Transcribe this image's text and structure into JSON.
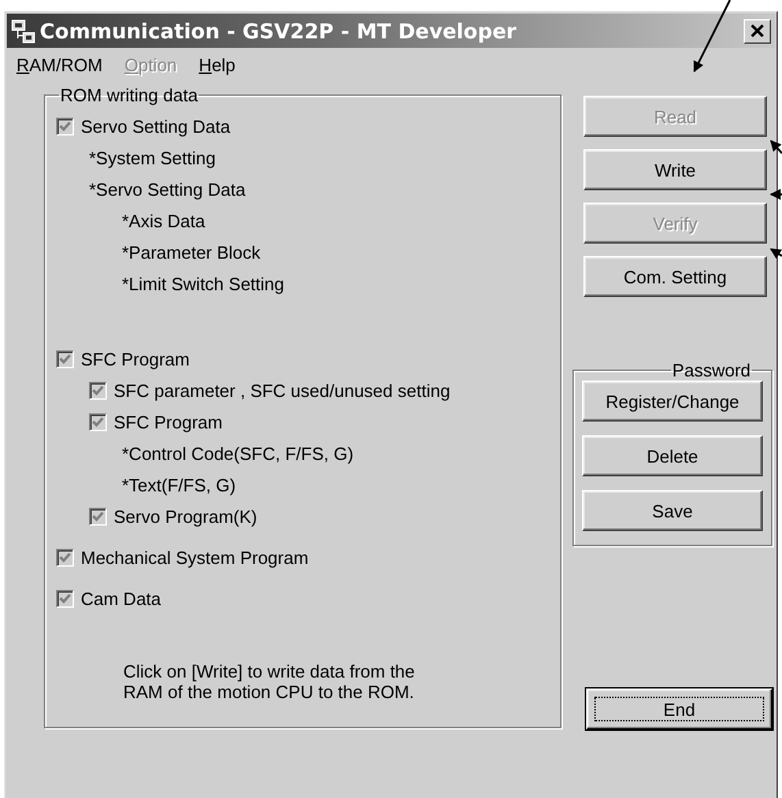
{
  "window": {
    "title": "Communication - GSV22P - MT Developer"
  },
  "menu": [
    {
      "label": "RAM/ROM",
      "disabled": false
    },
    {
      "label": "Option",
      "disabled": true
    },
    {
      "label": "Help",
      "disabled": false
    }
  ],
  "rom_group": {
    "title": "ROM writing data",
    "items": [
      {
        "kind": "checkbox",
        "label": "Servo Setting Data",
        "checked": true,
        "disabled": true,
        "children": [
          {
            "kind": "note",
            "label": "*System Setting"
          },
          {
            "kind": "note",
            "label": "*Servo Setting Data",
            "children": [
              {
                "kind": "note",
                "label": "*Axis Data"
              },
              {
                "kind": "note",
                "label": "*Parameter Block"
              },
              {
                "kind": "note",
                "label": "*Limit Switch Setting"
              }
            ]
          }
        ]
      },
      {
        "kind": "checkbox",
        "label": "SFC Program",
        "checked": true,
        "disabled": true,
        "children": [
          {
            "kind": "checkbox",
            "label": "SFC parameter , SFC used/unused setting",
            "checked": true,
            "disabled": true
          },
          {
            "kind": "checkbox",
            "label": "SFC Program",
            "checked": true,
            "disabled": true,
            "children": [
              {
                "kind": "note",
                "label": "*Control Code(SFC, F/FS, G)"
              },
              {
                "kind": "note",
                "label": "*Text(F/FS, G)"
              }
            ]
          },
          {
            "kind": "checkbox",
            "label": "Servo Program(K)",
            "checked": true,
            "disabled": true
          }
        ]
      },
      {
        "kind": "checkbox",
        "label": "Mechanical System Program",
        "checked": true,
        "disabled": true
      },
      {
        "kind": "checkbox",
        "label": "Cam Data",
        "checked": true,
        "disabled": true
      }
    ],
    "note_lines": [
      "Click on [Write] to write data from the",
      "RAM of the motion CPU to the ROM."
    ]
  },
  "buttons": [
    {
      "label": "Read",
      "disabled": true
    },
    {
      "label": "Write",
      "disabled": false
    },
    {
      "label": "Verify",
      "disabled": true
    },
    {
      "label": "Com. Setting",
      "disabled": false
    }
  ],
  "password_group": {
    "title": "Password",
    "buttons": [
      {
        "label": "Register/Change",
        "disabled": false
      },
      {
        "label": "Delete",
        "disabled": false
      },
      {
        "label": "Save",
        "disabled": false
      }
    ]
  },
  "end_button": {
    "label": "End",
    "default": true
  }
}
